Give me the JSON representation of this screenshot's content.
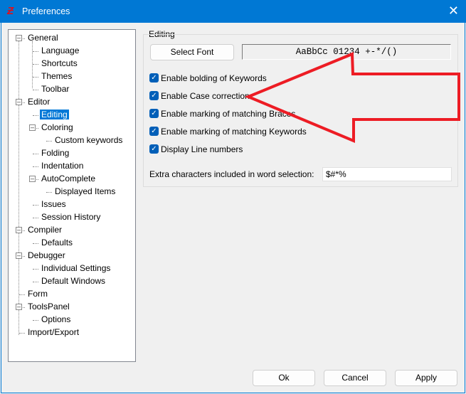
{
  "window": {
    "title": "Preferences",
    "app_icon": "Ƶ"
  },
  "tree": [
    {
      "label": "General",
      "level": 0,
      "expander": true
    },
    {
      "label": "Language",
      "level": 1
    },
    {
      "label": "Shortcuts",
      "level": 1
    },
    {
      "label": "Themes",
      "level": 1
    },
    {
      "label": "Toolbar",
      "level": 1
    },
    {
      "label": "Editor",
      "level": 0,
      "expander": true
    },
    {
      "label": "Editing",
      "level": 1,
      "selected": true
    },
    {
      "label": "Coloring",
      "level": 1,
      "expander": true
    },
    {
      "label": "Custom keywords",
      "level": 2
    },
    {
      "label": "Folding",
      "level": 1
    },
    {
      "label": "Indentation",
      "level": 1
    },
    {
      "label": "AutoComplete",
      "level": 1,
      "expander": true
    },
    {
      "label": "Displayed Items",
      "level": 2
    },
    {
      "label": "Issues",
      "level": 1
    },
    {
      "label": "Session History",
      "level": 1
    },
    {
      "label": "Compiler",
      "level": 0,
      "expander": true
    },
    {
      "label": "Defaults",
      "level": 1
    },
    {
      "label": "Debugger",
      "level": 0,
      "expander": true
    },
    {
      "label": "Individual Settings",
      "level": 1
    },
    {
      "label": "Default Windows",
      "level": 1
    },
    {
      "label": "Form",
      "level": 0
    },
    {
      "label": "ToolsPanel",
      "level": 0,
      "expander": true
    },
    {
      "label": "Options",
      "level": 1
    },
    {
      "label": "Import/Export",
      "level": 0
    }
  ],
  "editing": {
    "group_label": "Editing",
    "select_font": "Select Font",
    "font_preview": "AaBbCc 01234 +-*/()",
    "checkboxes": [
      {
        "label": "Enable bolding of Keywords",
        "checked": true
      },
      {
        "label": "Enable Case correction",
        "checked": true
      },
      {
        "label": "Enable marking of matching Braces",
        "checked": true
      },
      {
        "label": "Enable marking of matching Keywords",
        "checked": true
      },
      {
        "label": "Display Line numbers",
        "checked": true
      }
    ],
    "extra_chars_label": "Extra characters included in word selection:",
    "extra_chars_value": "$#*%"
  },
  "buttons": {
    "ok": "Ok",
    "cancel": "Cancel",
    "apply": "Apply"
  },
  "annotation": {
    "color": "#ed1c24"
  }
}
